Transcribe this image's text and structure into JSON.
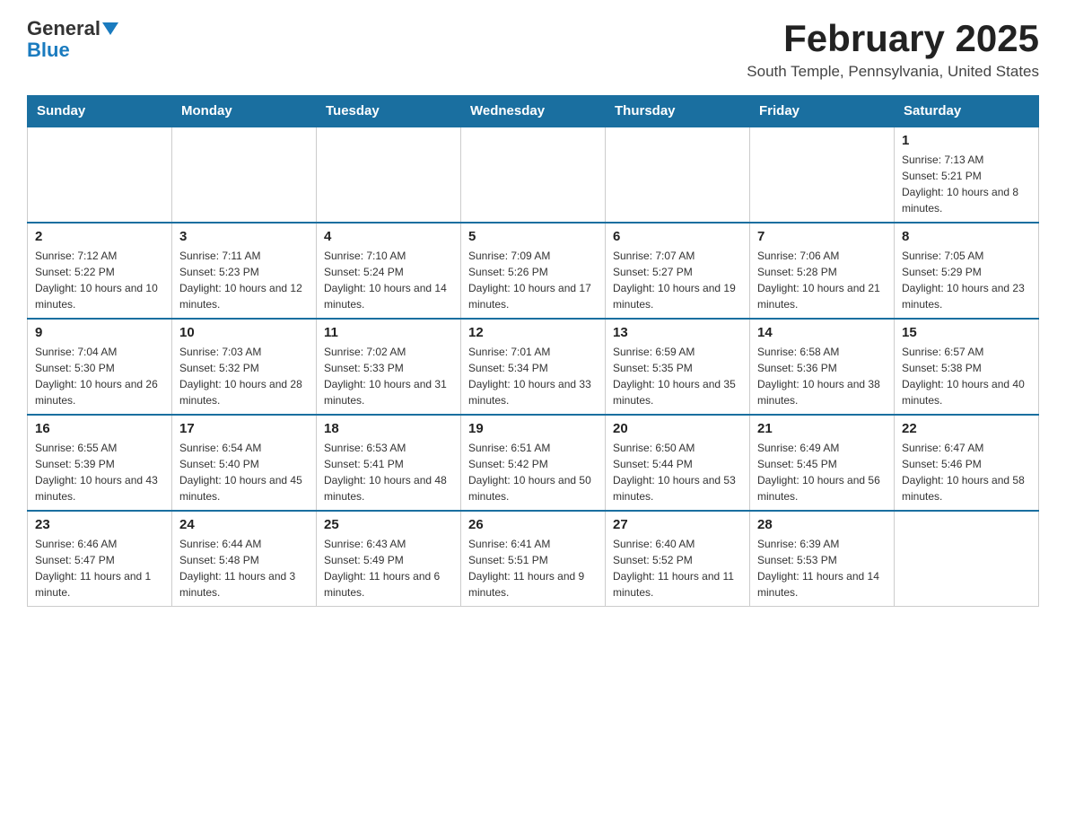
{
  "logo": {
    "general": "General",
    "blue": "Blue"
  },
  "header": {
    "month_year": "February 2025",
    "location": "South Temple, Pennsylvania, United States"
  },
  "weekdays": [
    "Sunday",
    "Monday",
    "Tuesday",
    "Wednesday",
    "Thursday",
    "Friday",
    "Saturday"
  ],
  "weeks": [
    [
      {
        "day": "",
        "info": ""
      },
      {
        "day": "",
        "info": ""
      },
      {
        "day": "",
        "info": ""
      },
      {
        "day": "",
        "info": ""
      },
      {
        "day": "",
        "info": ""
      },
      {
        "day": "",
        "info": ""
      },
      {
        "day": "1",
        "info": "Sunrise: 7:13 AM\nSunset: 5:21 PM\nDaylight: 10 hours and 8 minutes."
      }
    ],
    [
      {
        "day": "2",
        "info": "Sunrise: 7:12 AM\nSunset: 5:22 PM\nDaylight: 10 hours and 10 minutes."
      },
      {
        "day": "3",
        "info": "Sunrise: 7:11 AM\nSunset: 5:23 PM\nDaylight: 10 hours and 12 minutes."
      },
      {
        "day": "4",
        "info": "Sunrise: 7:10 AM\nSunset: 5:24 PM\nDaylight: 10 hours and 14 minutes."
      },
      {
        "day": "5",
        "info": "Sunrise: 7:09 AM\nSunset: 5:26 PM\nDaylight: 10 hours and 17 minutes."
      },
      {
        "day": "6",
        "info": "Sunrise: 7:07 AM\nSunset: 5:27 PM\nDaylight: 10 hours and 19 minutes."
      },
      {
        "day": "7",
        "info": "Sunrise: 7:06 AM\nSunset: 5:28 PM\nDaylight: 10 hours and 21 minutes."
      },
      {
        "day": "8",
        "info": "Sunrise: 7:05 AM\nSunset: 5:29 PM\nDaylight: 10 hours and 23 minutes."
      }
    ],
    [
      {
        "day": "9",
        "info": "Sunrise: 7:04 AM\nSunset: 5:30 PM\nDaylight: 10 hours and 26 minutes."
      },
      {
        "day": "10",
        "info": "Sunrise: 7:03 AM\nSunset: 5:32 PM\nDaylight: 10 hours and 28 minutes."
      },
      {
        "day": "11",
        "info": "Sunrise: 7:02 AM\nSunset: 5:33 PM\nDaylight: 10 hours and 31 minutes."
      },
      {
        "day": "12",
        "info": "Sunrise: 7:01 AM\nSunset: 5:34 PM\nDaylight: 10 hours and 33 minutes."
      },
      {
        "day": "13",
        "info": "Sunrise: 6:59 AM\nSunset: 5:35 PM\nDaylight: 10 hours and 35 minutes."
      },
      {
        "day": "14",
        "info": "Sunrise: 6:58 AM\nSunset: 5:36 PM\nDaylight: 10 hours and 38 minutes."
      },
      {
        "day": "15",
        "info": "Sunrise: 6:57 AM\nSunset: 5:38 PM\nDaylight: 10 hours and 40 minutes."
      }
    ],
    [
      {
        "day": "16",
        "info": "Sunrise: 6:55 AM\nSunset: 5:39 PM\nDaylight: 10 hours and 43 minutes."
      },
      {
        "day": "17",
        "info": "Sunrise: 6:54 AM\nSunset: 5:40 PM\nDaylight: 10 hours and 45 minutes."
      },
      {
        "day": "18",
        "info": "Sunrise: 6:53 AM\nSunset: 5:41 PM\nDaylight: 10 hours and 48 minutes."
      },
      {
        "day": "19",
        "info": "Sunrise: 6:51 AM\nSunset: 5:42 PM\nDaylight: 10 hours and 50 minutes."
      },
      {
        "day": "20",
        "info": "Sunrise: 6:50 AM\nSunset: 5:44 PM\nDaylight: 10 hours and 53 minutes."
      },
      {
        "day": "21",
        "info": "Sunrise: 6:49 AM\nSunset: 5:45 PM\nDaylight: 10 hours and 56 minutes."
      },
      {
        "day": "22",
        "info": "Sunrise: 6:47 AM\nSunset: 5:46 PM\nDaylight: 10 hours and 58 minutes."
      }
    ],
    [
      {
        "day": "23",
        "info": "Sunrise: 6:46 AM\nSunset: 5:47 PM\nDaylight: 11 hours and 1 minute."
      },
      {
        "day": "24",
        "info": "Sunrise: 6:44 AM\nSunset: 5:48 PM\nDaylight: 11 hours and 3 minutes."
      },
      {
        "day": "25",
        "info": "Sunrise: 6:43 AM\nSunset: 5:49 PM\nDaylight: 11 hours and 6 minutes."
      },
      {
        "day": "26",
        "info": "Sunrise: 6:41 AM\nSunset: 5:51 PM\nDaylight: 11 hours and 9 minutes."
      },
      {
        "day": "27",
        "info": "Sunrise: 6:40 AM\nSunset: 5:52 PM\nDaylight: 11 hours and 11 minutes."
      },
      {
        "day": "28",
        "info": "Sunrise: 6:39 AM\nSunset: 5:53 PM\nDaylight: 11 hours and 14 minutes."
      },
      {
        "day": "",
        "info": ""
      }
    ]
  ]
}
